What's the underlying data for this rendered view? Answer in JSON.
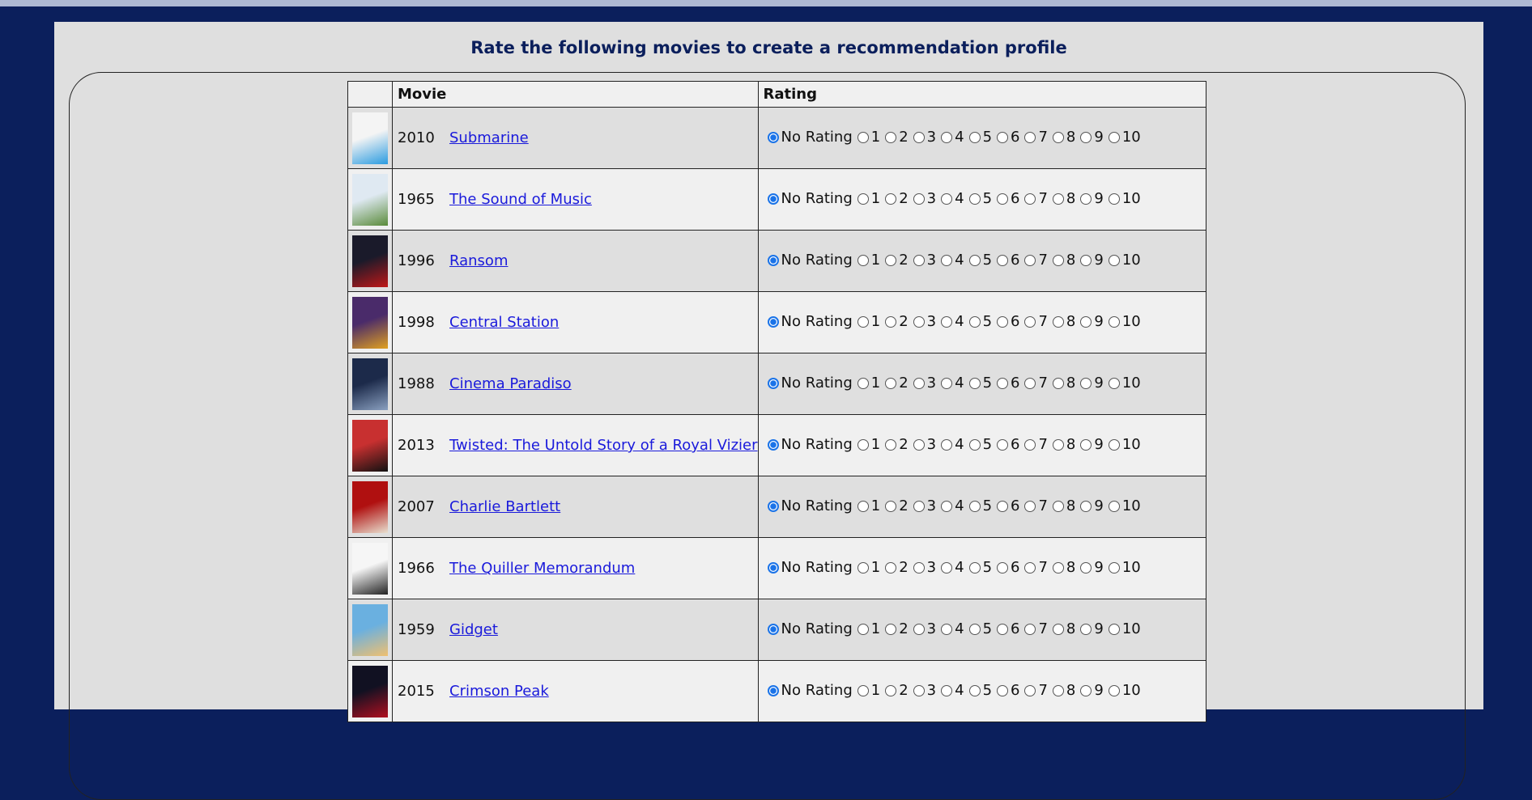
{
  "page": {
    "title": "Rate the following movies to create a recommendation profile"
  },
  "table": {
    "headers": {
      "thumbnail": "",
      "movie": "Movie",
      "rating": "Rating"
    },
    "rating_options": [
      "No Rating",
      "1",
      "2",
      "3",
      "4",
      "5",
      "6",
      "7",
      "8",
      "9",
      "10"
    ],
    "selected_rating": "No Rating",
    "movies": [
      {
        "year": "2010",
        "title": "Submarine",
        "poster_colors": [
          "#f4f4f4",
          "#2a9be0"
        ]
      },
      {
        "year": "1965",
        "title": "The Sound of Music",
        "poster_colors": [
          "#dfe9f2",
          "#5a8b3a"
        ]
      },
      {
        "year": "1996",
        "title": "Ransom",
        "poster_colors": [
          "#1a1a2a",
          "#c01818"
        ]
      },
      {
        "year": "1998",
        "title": "Central Station",
        "poster_colors": [
          "#4a2b6a",
          "#e0a020"
        ]
      },
      {
        "year": "1988",
        "title": "Cinema Paradiso",
        "poster_colors": [
          "#1c2a4a",
          "#8aa0c0"
        ]
      },
      {
        "year": "2013",
        "title": "Twisted: The Untold Story of a Royal Vizier",
        "poster_colors": [
          "#c83030",
          "#111111"
        ]
      },
      {
        "year": "2007",
        "title": "Charlie Bartlett",
        "poster_colors": [
          "#b01010",
          "#e8e0d0"
        ]
      },
      {
        "year": "1966",
        "title": "The Quiller Memorandum",
        "poster_colors": [
          "#f6f6f6",
          "#222222"
        ]
      },
      {
        "year": "1959",
        "title": "Gidget",
        "poster_colors": [
          "#6ab0e0",
          "#f0c070"
        ]
      },
      {
        "year": "2015",
        "title": "Crimson Peak",
        "poster_colors": [
          "#111122",
          "#b01020"
        ]
      }
    ]
  }
}
